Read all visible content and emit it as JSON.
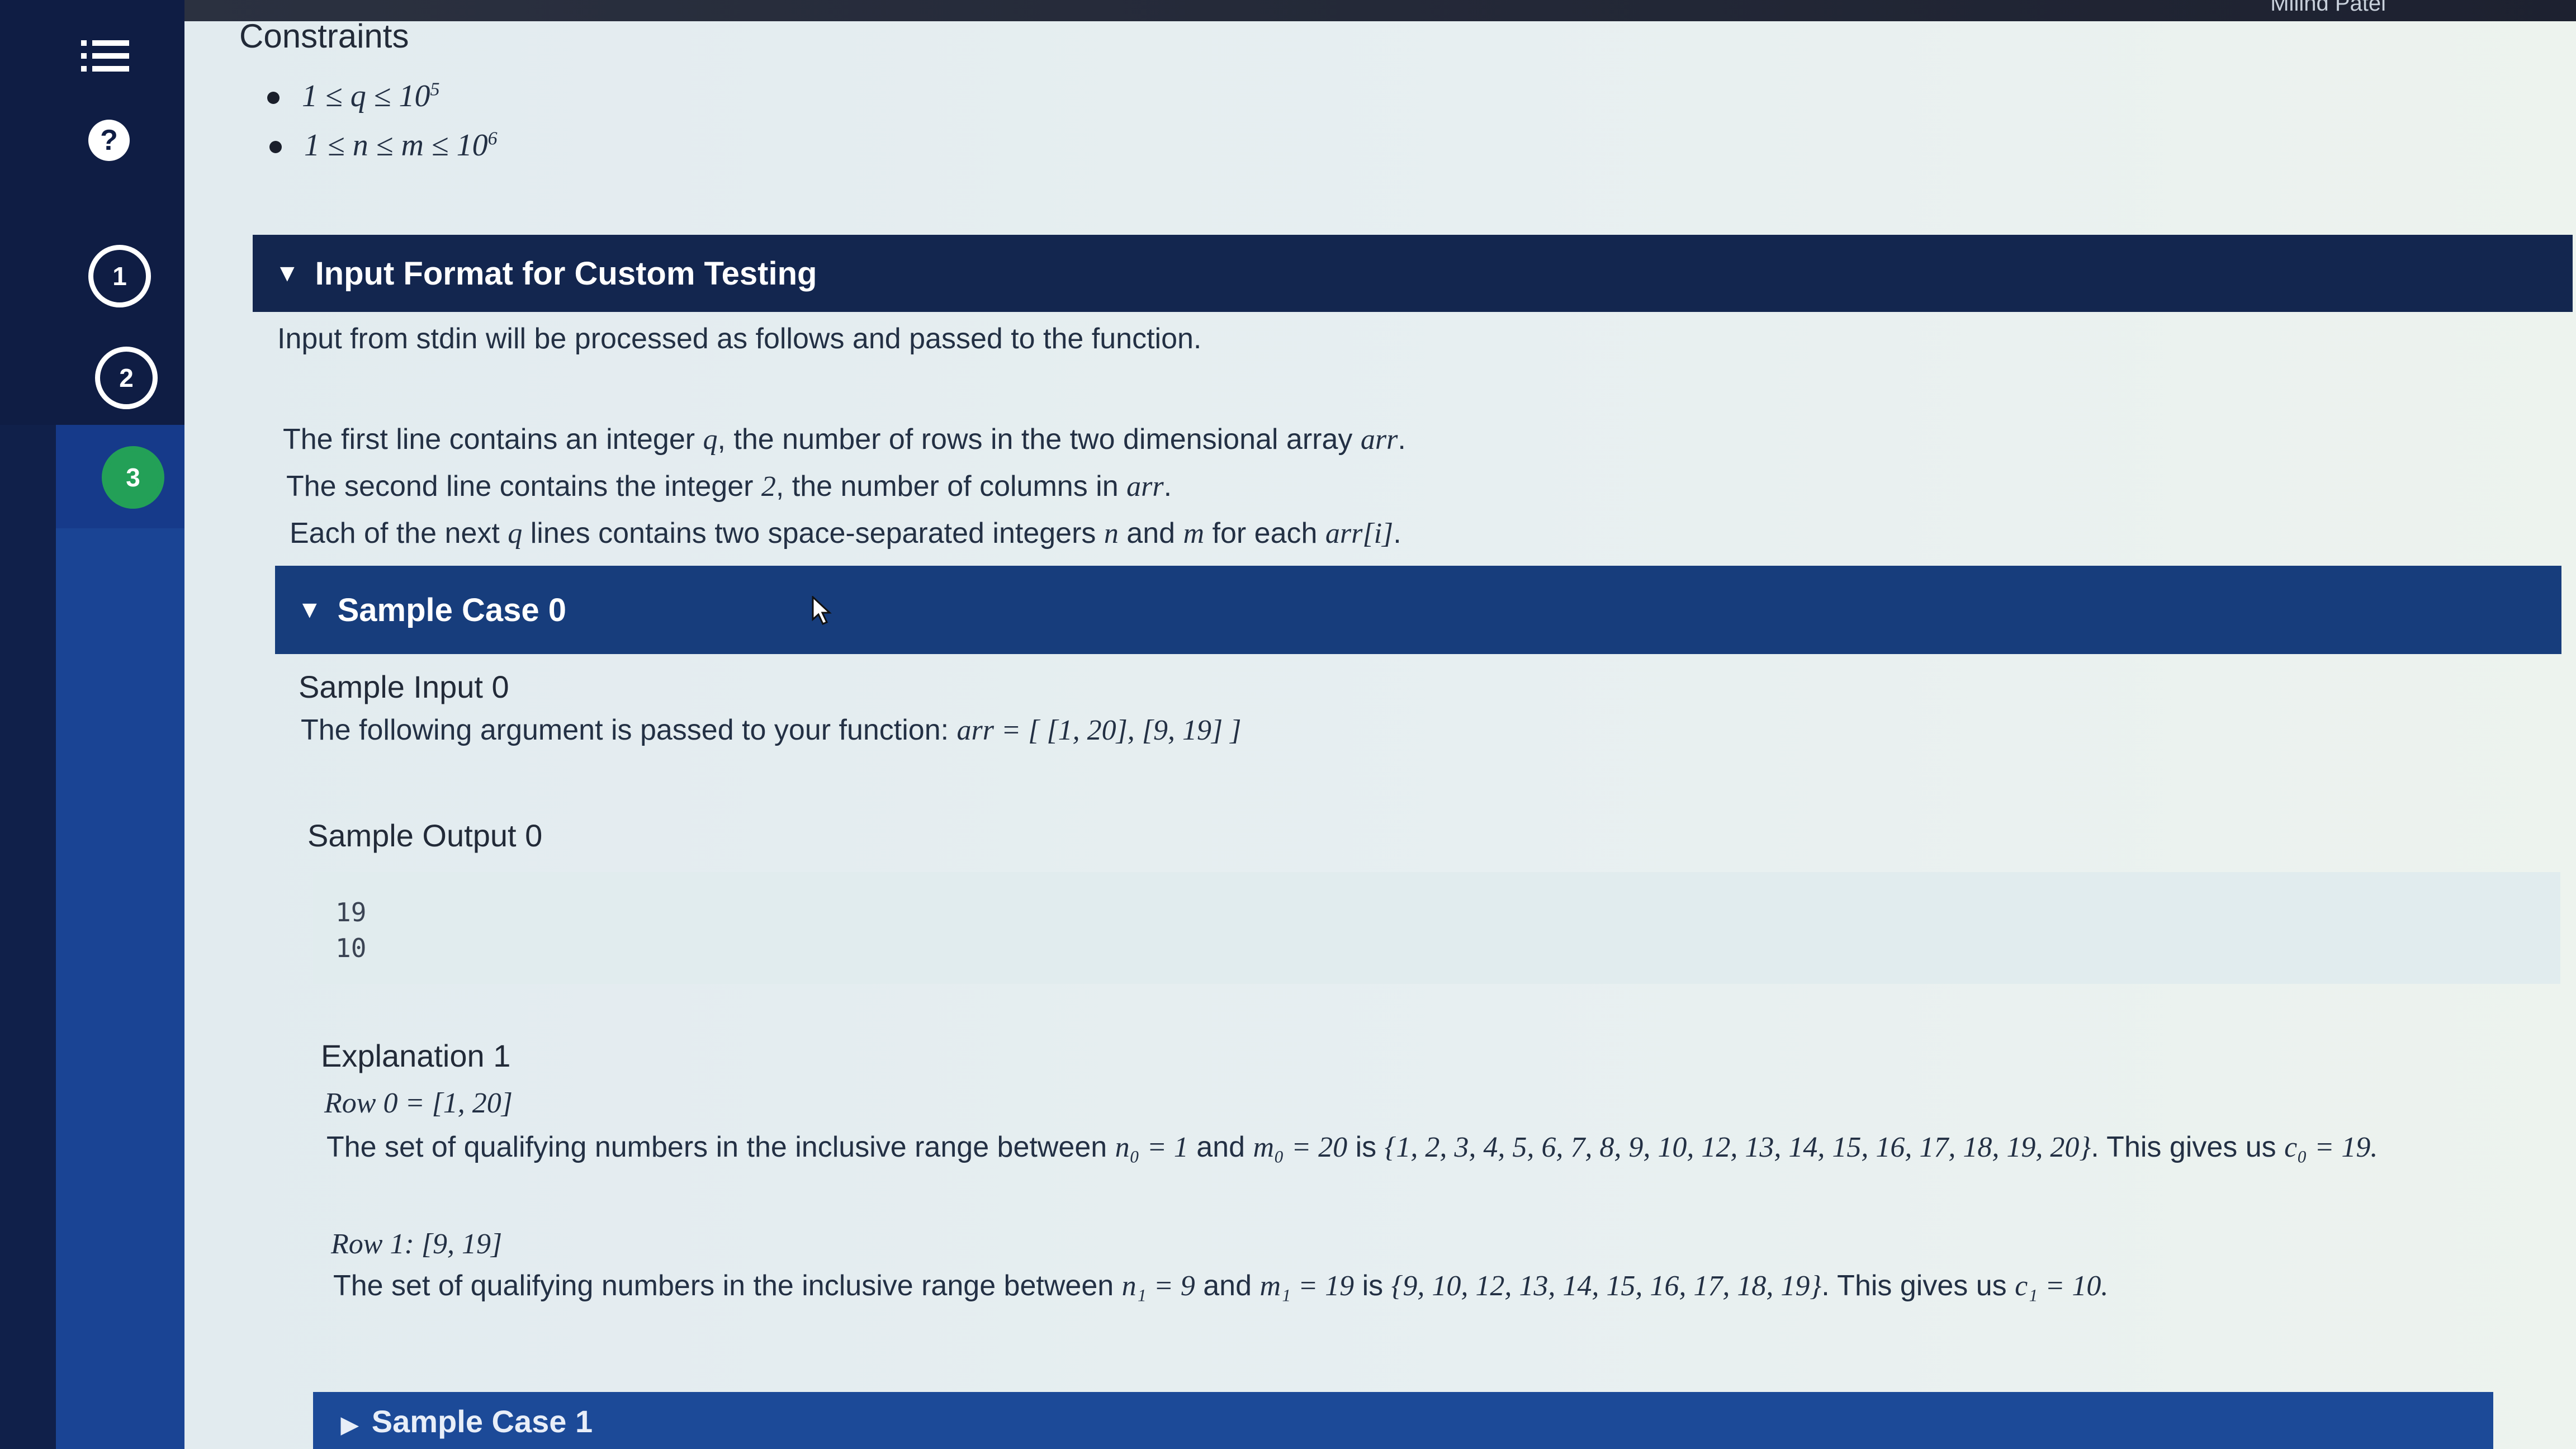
{
  "header": {
    "user_name": "Milind Patel"
  },
  "sidebar": {
    "help_symbol": "?",
    "steps": [
      "1",
      "2",
      "3"
    ]
  },
  "constraints": {
    "title": "Constraints",
    "items": [
      {
        "text": "1 ≤ q ≤ 10",
        "sup": "5"
      },
      {
        "text": "1 ≤ n ≤ m ≤ 10",
        "sup": "6"
      }
    ]
  },
  "input_format": {
    "title": "Input Format for Custom Testing",
    "intro": "Input from stdin will be processed as follows and passed to the function.",
    "line1": {
      "a": "The first line contains an integer ",
      "q": "q",
      "b": ", the number of rows in the two dimensional array ",
      "arr": "arr",
      "c": "."
    },
    "line2": {
      "a": "The second line contains the integer ",
      "two": "2",
      "b": ", the number of columns in ",
      "arr": "arr",
      "c": "."
    },
    "line3": {
      "a": "Each of the next ",
      "q": "q",
      "b": " lines contains two space-separated integers ",
      "n": "n",
      "c": " and ",
      "m": "m",
      "d": " for each ",
      "arri": "arr[i]",
      "e": "."
    }
  },
  "sample_case_0": {
    "title": "Sample Case 0",
    "input_title": "Sample Input 0",
    "input_text": "The following argument is passed to your function: ",
    "input_value": "arr = [ [1, 20], [9, 19] ]",
    "output_title": "Sample Output 0",
    "output_lines": [
      "19",
      "10"
    ]
  },
  "explanation": {
    "title": "Explanation 1",
    "row0_label": "Row 0 = [1, 20]",
    "row0_text_a": "The set of qualifying numbers in the inclusive range between ",
    "row0_n": "n₀ = 1",
    "row0_text_b": " and ",
    "row0_m": "m₀ = 20",
    "row0_text_c": " is ",
    "row0_set": "{1, 2, 3, 4, 5, 6, 7, 8, 9, 10, 12, 13, 14, 15, 16, 17, 18, 19, 20}",
    "row0_text_d": ". This gives us ",
    "row0_c": "c₀ = 19.",
    "row1_label": "Row 1: [9, 19]",
    "row1_text_a": "The set of qualifying numbers in the inclusive range between ",
    "row1_n": "n₁ = 9",
    "row1_text_b": " and ",
    "row1_m": "m₁ = 19",
    "row1_text_c": " is ",
    "row1_set": "{9, 10, 12, 13, 14, 15, 16, 17, 18, 19}",
    "row1_text_d": ". This gives us ",
    "row1_c": "c₁ = 10."
  },
  "sample_case_1": {
    "title": "Sample Case 1"
  }
}
